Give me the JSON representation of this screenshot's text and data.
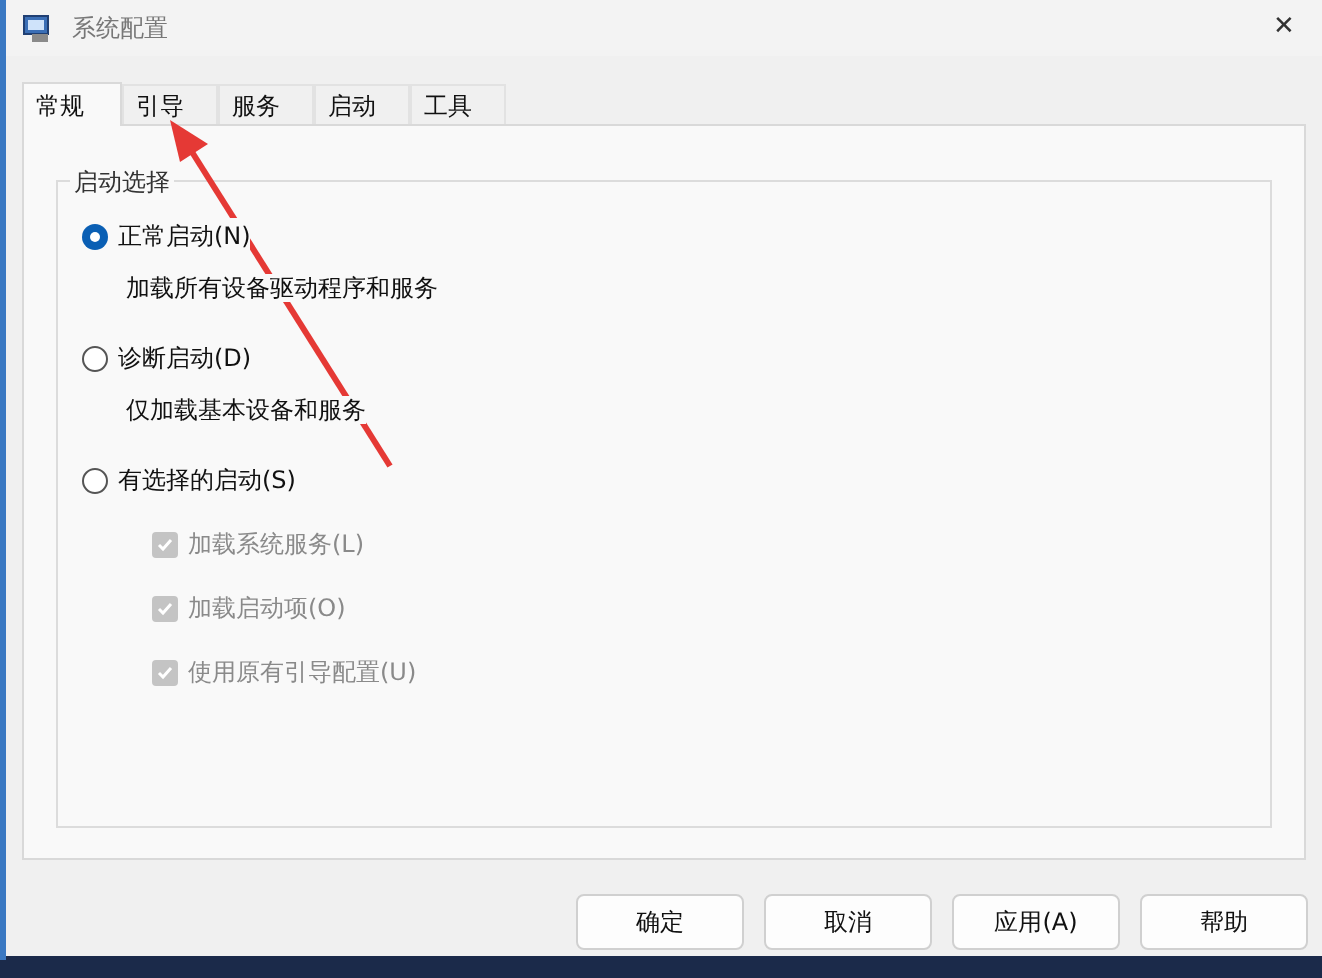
{
  "window": {
    "title": "系统配置",
    "close": "✕"
  },
  "tabs": [
    {
      "label": "常规",
      "selected": true
    },
    {
      "label": "引导",
      "selected": false
    },
    {
      "label": "服务",
      "selected": false
    },
    {
      "label": "启动",
      "selected": false
    },
    {
      "label": "工具",
      "selected": false
    }
  ],
  "group": {
    "legend": "启动选择",
    "options": [
      {
        "label": "正常启动(N)",
        "description": "加载所有设备驱动程序和服务",
        "selected": true
      },
      {
        "label": "诊断启动(D)",
        "description": "仅加载基本设备和服务",
        "selected": false
      },
      {
        "label": "有选择的启动(S)",
        "selected": false,
        "children": [
          {
            "label": "加载系统服务(L)",
            "checked": true,
            "disabled": true
          },
          {
            "label": "加载启动项(O)",
            "checked": true,
            "disabled": true
          },
          {
            "label": "使用原有引导配置(U)",
            "checked": true,
            "disabled": true
          }
        ]
      }
    ]
  },
  "buttons": [
    "确定",
    "取消",
    "应用(A)",
    "帮助"
  ]
}
